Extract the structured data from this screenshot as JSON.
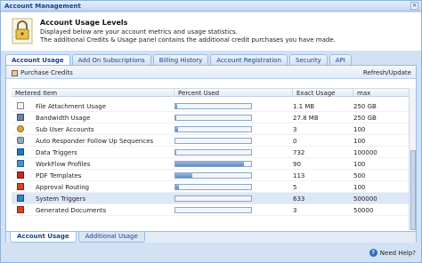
{
  "window": {
    "title": "Account Management"
  },
  "header": {
    "title": "Account Usage Levels",
    "line1": "Displayed below are your account metrics and usage statistics.",
    "line2": "The additional Credits & Usage panel contains the additional credit purchases you have made."
  },
  "tabs": [
    {
      "label": "Account Usage",
      "active": true
    },
    {
      "label": "Add On Subscriptions"
    },
    {
      "label": "Billing History"
    },
    {
      "label": "Account Registration"
    },
    {
      "label": "Security"
    },
    {
      "label": "API"
    }
  ],
  "toolbar": {
    "purchase_label": "Purchase Credits",
    "refresh_label": "Refresh/Update"
  },
  "grid": {
    "columns": [
      "Metered Item",
      "Percent Used",
      "Exact Usage",
      "max"
    ],
    "rows": [
      {
        "icon": "document-icon",
        "name": "File Attachment Usage",
        "percent": 0.02,
        "usage": "1.1 MB",
        "max": "250 GB"
      },
      {
        "icon": "disk-icon",
        "name": "Bandwidth Usage",
        "percent": 0.01,
        "usage": "27.8 MB",
        "max": "250 GB"
      },
      {
        "icon": "user-icon",
        "name": "Sub User Accounts",
        "percent": 0.03,
        "usage": "3",
        "max": "100"
      },
      {
        "icon": "gear-icon",
        "name": "Auto Responder Follow Up Sequences",
        "percent": 0.0,
        "usage": "0",
        "max": "100"
      },
      {
        "icon": "database-icon",
        "name": "Data Triggers",
        "percent": 0.01,
        "usage": "732",
        "max": "100000"
      },
      {
        "icon": "workflow-icon",
        "name": "WorkFlow Profiles",
        "percent": 0.9,
        "usage": "90",
        "max": "100"
      },
      {
        "icon": "pdf-icon",
        "name": "PDF Templates",
        "percent": 0.226,
        "usage": "113",
        "max": "500"
      },
      {
        "icon": "routing-icon",
        "name": "Approval Routing",
        "percent": 0.05,
        "usage": "5",
        "max": "100"
      },
      {
        "icon": "system-trigger-icon",
        "name": "System Triggers",
        "percent": 0.0,
        "usage": "633",
        "max": "500000",
        "selected": true
      },
      {
        "icon": "generated-doc-icon",
        "name": "Generated Documents",
        "percent": 0.0,
        "usage": "3",
        "max": "50000"
      }
    ]
  },
  "subtabs": [
    {
      "label": "Account Usage",
      "active": true
    },
    {
      "label": "Additional Usage"
    }
  ],
  "footer": {
    "help_label": "Need Help?"
  }
}
